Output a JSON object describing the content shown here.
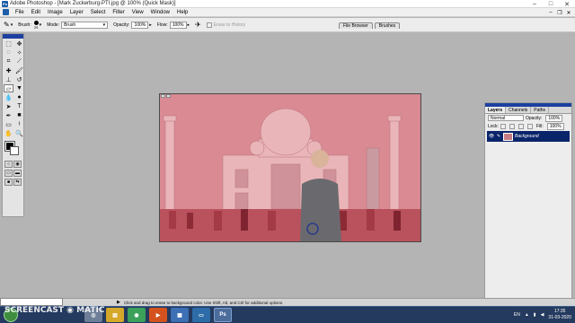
{
  "window": {
    "title": "Adobe Photoshop - [Mark Zuckerburg-PTI.jpg @ 100% (Quick Mask)]",
    "controls": [
      "–",
      "□",
      "✕"
    ]
  },
  "menubar": {
    "items": [
      "File",
      "Edit",
      "Image",
      "Layer",
      "Select",
      "Filter",
      "View",
      "Window",
      "Help"
    ],
    "doc_controls": [
      "–",
      "❐",
      "✕"
    ]
  },
  "optionsbar": {
    "brush_label": "Brush:",
    "brush_size": "29",
    "mode_label": "Mode:",
    "mode_value": "Brush",
    "opacity_label": "Opacity:",
    "opacity_value": "100%",
    "flow_label": "Flow:",
    "flow_value": "100%",
    "erase_history_label": "Erase to History"
  },
  "palette_well": {
    "tabs": [
      "File Browser",
      "Brushes"
    ]
  },
  "layers_palette": {
    "tabs": [
      "Layers",
      "Channels",
      "Paths"
    ],
    "blend_mode": "Normal",
    "opacity_label": "Opacity:",
    "opacity_value": "100%",
    "lock_label": "Lock:",
    "fill_label": "Fill:",
    "fill_value": "100%",
    "layer_name": "Background"
  },
  "status": {
    "zoom": "100%",
    "hint": "Click and drag to erase to background color. Use Shift, Alt, and Ctrl for additional options."
  },
  "taskbar": {
    "watermark": "SCREENCAST ◉ MATIC",
    "language": "EN",
    "time": "17:35",
    "date": "31-03-2020"
  },
  "colors": {
    "quickmask_overlay": "#c77c84",
    "title_accent": "#1c3fa0",
    "taskbar": "#243a5e"
  }
}
